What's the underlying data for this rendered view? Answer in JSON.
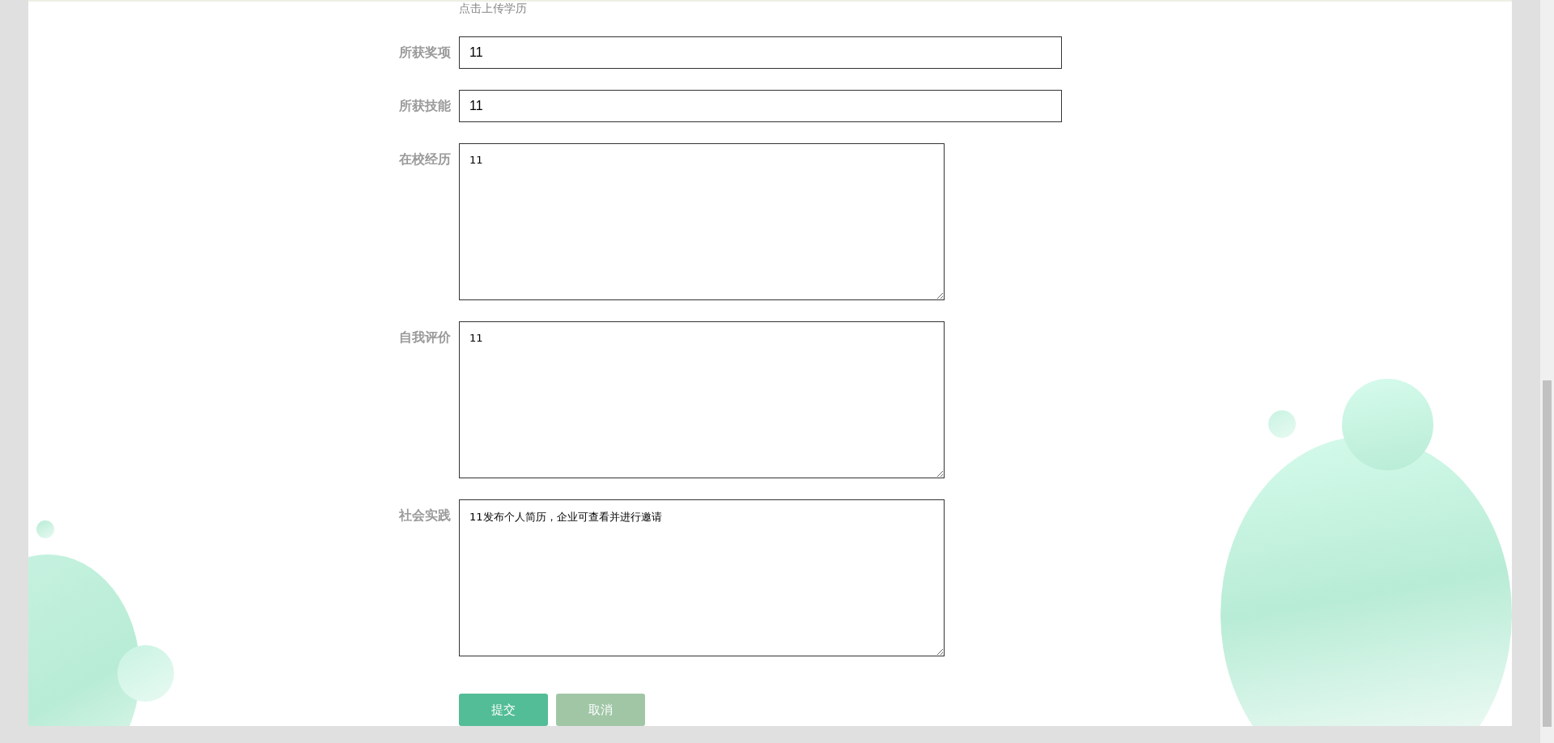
{
  "upload_hint": "点击上传学历",
  "fields": [
    {
      "label": "所获奖项",
      "kind": "input",
      "value": "11"
    },
    {
      "label": "所获技能",
      "kind": "input",
      "value": "11"
    },
    {
      "label": "在校经历",
      "kind": "textarea",
      "value": "11"
    },
    {
      "label": "自我评价",
      "kind": "textarea",
      "value": "11"
    },
    {
      "label": "社会实践",
      "kind": "textarea",
      "value": "11发布个人简历，企业可查看并进行邀请"
    }
  ],
  "buttons": [
    {
      "label": "提交",
      "kind": "primary"
    },
    {
      "label": "取消",
      "kind": "secondary"
    }
  ]
}
